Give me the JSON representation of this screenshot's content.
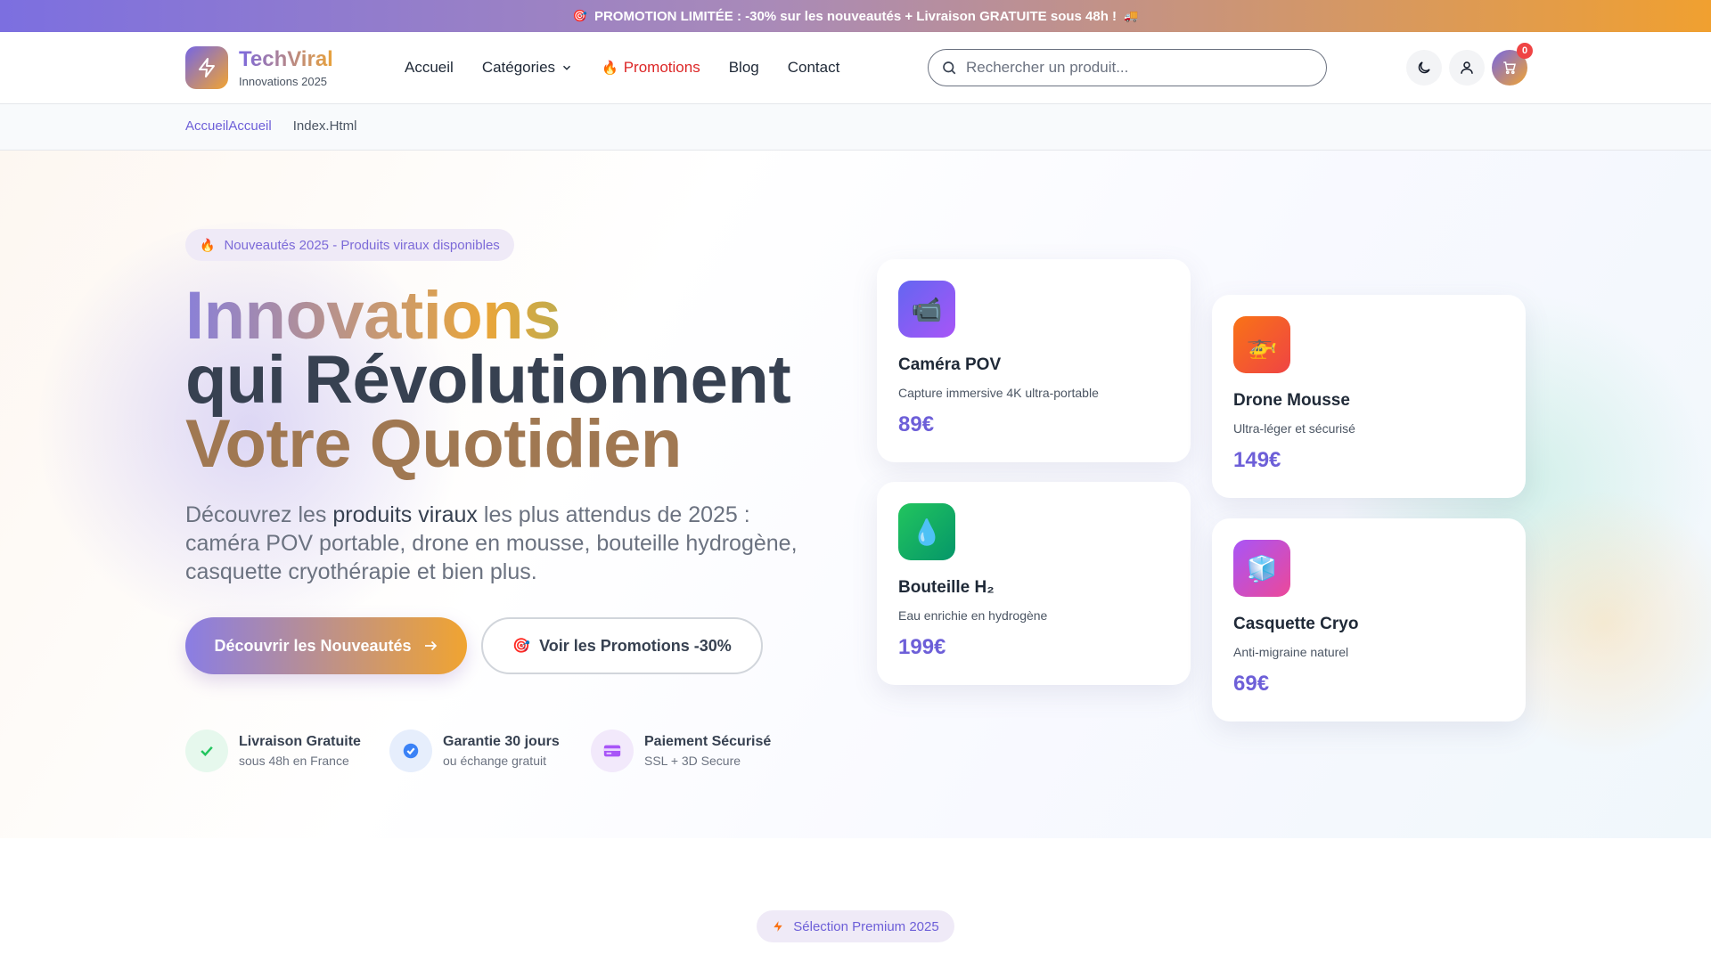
{
  "promo": {
    "text": "PROMOTION LIMITÉE : -30% sur les nouveautés + Livraison GRATUITE sous 48h !",
    "icon_left": "target-icon",
    "icon_right": "truck-icon"
  },
  "brand": {
    "name": "TechViral",
    "tagline": "Innovations 2025",
    "icon": "lightning-icon",
    "gradient_start": "#7566e4",
    "gradient_end": "#f2a431"
  },
  "nav": {
    "home": "Accueil",
    "categories": "Catégories",
    "promotions": "Promotions",
    "blog": "Blog",
    "contact": "Contact"
  },
  "search": {
    "placeholder": "Rechercher un produit..."
  },
  "header_actions": {
    "cart_count": "0"
  },
  "breadcrumb": {
    "home": "AccueilAccueil",
    "current": "Index.Html"
  },
  "hero": {
    "badge": "Nouveautés 2025 - Produits viraux disponibles",
    "title_line1": "Innovations",
    "title_line2": "qui Révolutionnent",
    "title_line3": "Votre Quotidien",
    "desc_before": "Découvrez les ",
    "desc_strong": "produits viraux",
    "desc_after": " les plus attendus de 2025 : caméra POV portable, drone en mousse, bouteille hydrogène, casquette cryothérapie et bien plus.",
    "cta_primary": "Découvrir les Nouveautés",
    "cta_secondary": "Voir les Promotions -30%"
  },
  "features": [
    {
      "title": "Livraison Gratuite",
      "subtitle": "sous 48h en France",
      "icon": "check-icon",
      "color": "#22c55e"
    },
    {
      "title": "Garantie 30 jours",
      "subtitle": "ou échange gratuit",
      "icon": "shield-check-icon",
      "color": "#3b82f6"
    },
    {
      "title": "Paiement Sécurisé",
      "subtitle": "SSL + 3D Secure",
      "icon": "credit-card-icon",
      "color": "#a855f7"
    }
  ],
  "products": [
    {
      "name": "Caméra POV",
      "description": "Capture immersive 4K ultra-portable",
      "price": "89€",
      "icon": "camera-icon"
    },
    {
      "name": "Drone Mousse",
      "description": "Ultra-léger et sécurisé",
      "price": "149€",
      "icon": "helicopter-icon"
    },
    {
      "name": "Bouteille H₂",
      "description": "Eau enrichie en hydrogène",
      "price": "199€",
      "icon": "droplet-icon"
    },
    {
      "name": "Casquette Cryo",
      "description": "Anti-migraine naturel",
      "price": "69€",
      "icon": "ice-cube-icon"
    }
  ],
  "section": {
    "badge": "Sélection Premium 2025"
  },
  "colors": {
    "accent": "#6d5fd8",
    "promo_red": "#dc2626"
  }
}
